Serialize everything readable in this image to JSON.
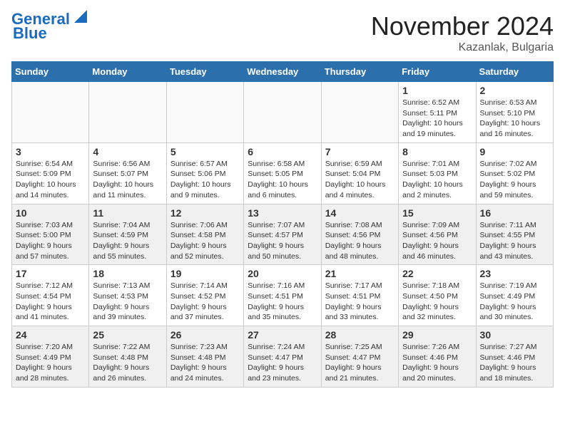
{
  "header": {
    "logo_line1": "General",
    "logo_line2": "Blue",
    "month_title": "November 2024",
    "location": "Kazanlak, Bulgaria"
  },
  "days_of_week": [
    "Sunday",
    "Monday",
    "Tuesday",
    "Wednesday",
    "Thursday",
    "Friday",
    "Saturday"
  ],
  "weeks": [
    [
      {
        "day": "",
        "info": ""
      },
      {
        "day": "",
        "info": ""
      },
      {
        "day": "",
        "info": ""
      },
      {
        "day": "",
        "info": ""
      },
      {
        "day": "",
        "info": ""
      },
      {
        "day": "1",
        "info": "Sunrise: 6:52 AM\nSunset: 5:11 PM\nDaylight: 10 hours and 19 minutes."
      },
      {
        "day": "2",
        "info": "Sunrise: 6:53 AM\nSunset: 5:10 PM\nDaylight: 10 hours and 16 minutes."
      }
    ],
    [
      {
        "day": "3",
        "info": "Sunrise: 6:54 AM\nSunset: 5:09 PM\nDaylight: 10 hours and 14 minutes."
      },
      {
        "day": "4",
        "info": "Sunrise: 6:56 AM\nSunset: 5:07 PM\nDaylight: 10 hours and 11 minutes."
      },
      {
        "day": "5",
        "info": "Sunrise: 6:57 AM\nSunset: 5:06 PM\nDaylight: 10 hours and 9 minutes."
      },
      {
        "day": "6",
        "info": "Sunrise: 6:58 AM\nSunset: 5:05 PM\nDaylight: 10 hours and 6 minutes."
      },
      {
        "day": "7",
        "info": "Sunrise: 6:59 AM\nSunset: 5:04 PM\nDaylight: 10 hours and 4 minutes."
      },
      {
        "day": "8",
        "info": "Sunrise: 7:01 AM\nSunset: 5:03 PM\nDaylight: 10 hours and 2 minutes."
      },
      {
        "day": "9",
        "info": "Sunrise: 7:02 AM\nSunset: 5:02 PM\nDaylight: 9 hours and 59 minutes."
      }
    ],
    [
      {
        "day": "10",
        "info": "Sunrise: 7:03 AM\nSunset: 5:00 PM\nDaylight: 9 hours and 57 minutes."
      },
      {
        "day": "11",
        "info": "Sunrise: 7:04 AM\nSunset: 4:59 PM\nDaylight: 9 hours and 55 minutes."
      },
      {
        "day": "12",
        "info": "Sunrise: 7:06 AM\nSunset: 4:58 PM\nDaylight: 9 hours and 52 minutes."
      },
      {
        "day": "13",
        "info": "Sunrise: 7:07 AM\nSunset: 4:57 PM\nDaylight: 9 hours and 50 minutes."
      },
      {
        "day": "14",
        "info": "Sunrise: 7:08 AM\nSunset: 4:56 PM\nDaylight: 9 hours and 48 minutes."
      },
      {
        "day": "15",
        "info": "Sunrise: 7:09 AM\nSunset: 4:56 PM\nDaylight: 9 hours and 46 minutes."
      },
      {
        "day": "16",
        "info": "Sunrise: 7:11 AM\nSunset: 4:55 PM\nDaylight: 9 hours and 43 minutes."
      }
    ],
    [
      {
        "day": "17",
        "info": "Sunrise: 7:12 AM\nSunset: 4:54 PM\nDaylight: 9 hours and 41 minutes."
      },
      {
        "day": "18",
        "info": "Sunrise: 7:13 AM\nSunset: 4:53 PM\nDaylight: 9 hours and 39 minutes."
      },
      {
        "day": "19",
        "info": "Sunrise: 7:14 AM\nSunset: 4:52 PM\nDaylight: 9 hours and 37 minutes."
      },
      {
        "day": "20",
        "info": "Sunrise: 7:16 AM\nSunset: 4:51 PM\nDaylight: 9 hours and 35 minutes."
      },
      {
        "day": "21",
        "info": "Sunrise: 7:17 AM\nSunset: 4:51 PM\nDaylight: 9 hours and 33 minutes."
      },
      {
        "day": "22",
        "info": "Sunrise: 7:18 AM\nSunset: 4:50 PM\nDaylight: 9 hours and 32 minutes."
      },
      {
        "day": "23",
        "info": "Sunrise: 7:19 AM\nSunset: 4:49 PM\nDaylight: 9 hours and 30 minutes."
      }
    ],
    [
      {
        "day": "24",
        "info": "Sunrise: 7:20 AM\nSunset: 4:49 PM\nDaylight: 9 hours and 28 minutes."
      },
      {
        "day": "25",
        "info": "Sunrise: 7:22 AM\nSunset: 4:48 PM\nDaylight: 9 hours and 26 minutes."
      },
      {
        "day": "26",
        "info": "Sunrise: 7:23 AM\nSunset: 4:48 PM\nDaylight: 9 hours and 24 minutes."
      },
      {
        "day": "27",
        "info": "Sunrise: 7:24 AM\nSunset: 4:47 PM\nDaylight: 9 hours and 23 minutes."
      },
      {
        "day": "28",
        "info": "Sunrise: 7:25 AM\nSunset: 4:47 PM\nDaylight: 9 hours and 21 minutes."
      },
      {
        "day": "29",
        "info": "Sunrise: 7:26 AM\nSunset: 4:46 PM\nDaylight: 9 hours and 20 minutes."
      },
      {
        "day": "30",
        "info": "Sunrise: 7:27 AM\nSunset: 4:46 PM\nDaylight: 9 hours and 18 minutes."
      }
    ]
  ]
}
